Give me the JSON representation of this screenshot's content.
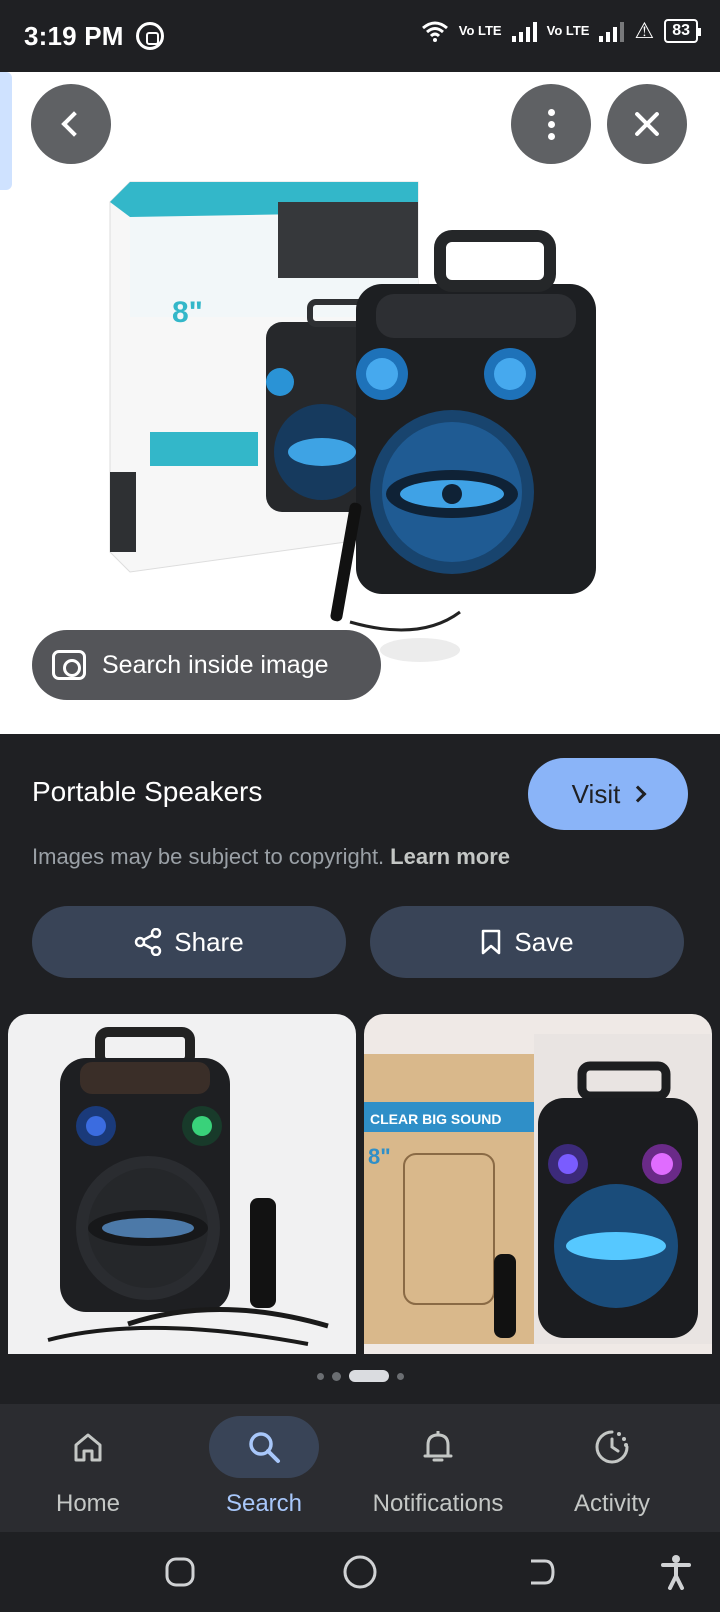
{
  "status_bar": {
    "time": "3:19 PM",
    "lte1": "Vo LTE",
    "lte2": "Vo LTE",
    "battery": "83"
  },
  "viewer": {
    "search_inside_label": "Search inside image"
  },
  "info": {
    "title": "Portable Speakers",
    "visit_label": "Visit",
    "copyright_text": "Images may be subject to copyright.",
    "learn_more": "Learn more",
    "share_label": "Share",
    "save_label": "Save"
  },
  "bottom_nav": {
    "items": [
      {
        "label": "Home",
        "icon": "home-icon"
      },
      {
        "label": "Search",
        "icon": "search-icon",
        "active": true
      },
      {
        "label": "Notifications",
        "icon": "bell-icon"
      },
      {
        "label": "Activity",
        "icon": "activity-icon"
      }
    ]
  },
  "colors": {
    "accent": "#8ab4f8",
    "button_bg": "#394457",
    "background": "#1f2023"
  }
}
